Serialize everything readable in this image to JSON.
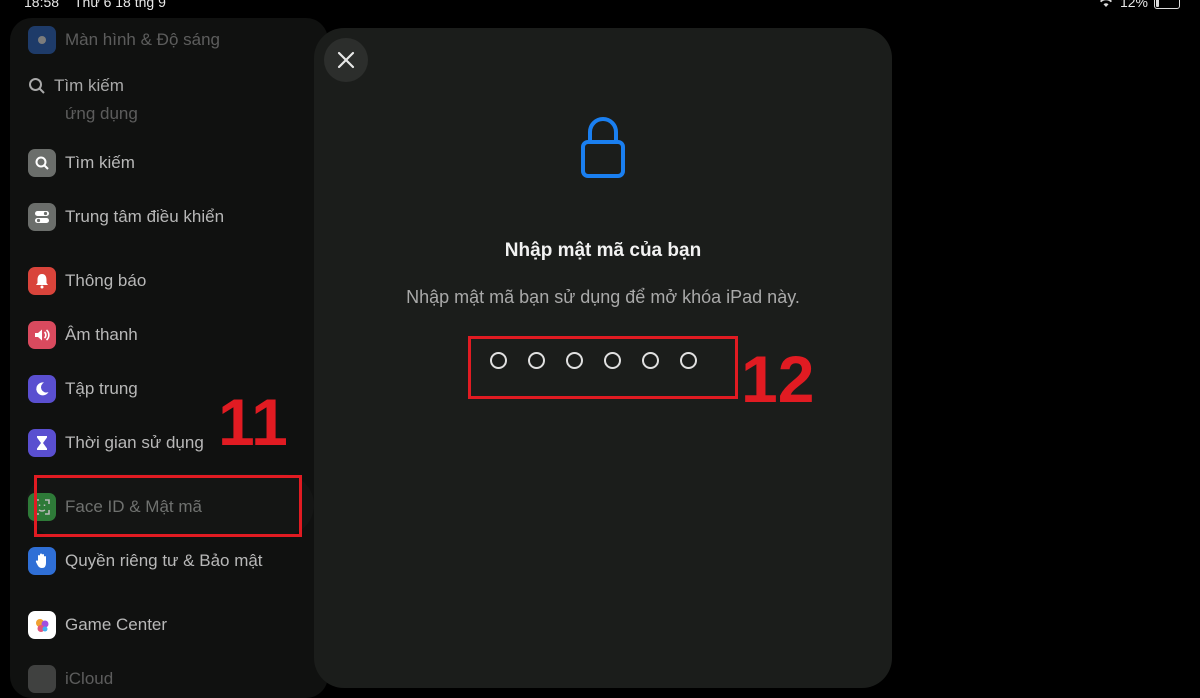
{
  "status_bar": {
    "time": "18:58",
    "date": "Thứ 6 18 thg 9",
    "battery": "12%"
  },
  "sidebar": {
    "search_placeholder": "Tìm kiếm",
    "items": [
      {
        "label": "Màn hình & Độ sáng",
        "icon": "display-icon",
        "color": "#2f6fd6"
      },
      {
        "label": "ứng dụng",
        "icon": "apps-icon",
        "color": "#2f6fd6"
      },
      {
        "label": "Tìm kiếm",
        "icon": "search-icon",
        "color": "#6b6e6b"
      },
      {
        "label": "Trung tâm điều khiển",
        "icon": "toggles-icon",
        "color": "#6b6e6b"
      },
      {
        "label": "Thông báo",
        "icon": "bell-icon",
        "color": "#d9443b"
      },
      {
        "label": "Âm thanh",
        "icon": "speaker-icon",
        "color": "#d94a5e"
      },
      {
        "label": "Tập trung",
        "icon": "moon-icon",
        "color": "#5a4fd0"
      },
      {
        "label": "Thời gian sử dụng",
        "icon": "hourglass-icon",
        "color": "#5a4fd0"
      },
      {
        "label": "Face ID & Mật mã",
        "icon": "faceid-icon",
        "color": "#3aa548"
      },
      {
        "label": "Quyền riêng tư & Bảo mật",
        "icon": "hand-icon",
        "color": "#2f6fd6"
      },
      {
        "label": "Game Center",
        "icon": "gamecenter-icon",
        "color": "#e0557d"
      },
      {
        "label": "iCloud",
        "icon": "cloud-icon",
        "color": "#7a7d7a"
      }
    ]
  },
  "modal": {
    "title": "Nhập mật mã của bạn",
    "subtitle": "Nhập mật mã bạn sử dụng để mở khóa iPad này.",
    "passcode_length": 6,
    "accent": "#1a7ff0"
  },
  "annotations": {
    "step_11": "11",
    "step_12": "12",
    "color": "#e11b22"
  }
}
